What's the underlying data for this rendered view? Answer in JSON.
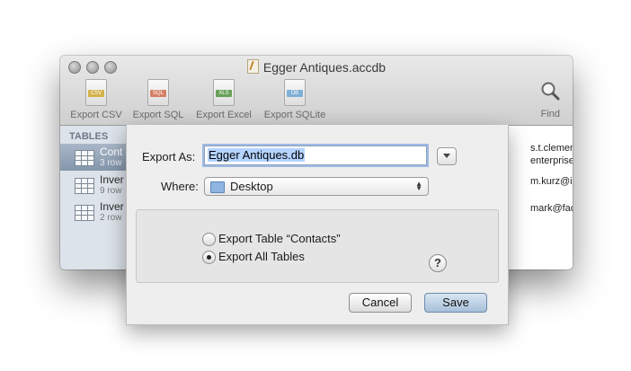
{
  "window": {
    "title": "Egger Antiques.accdb"
  },
  "toolbar": {
    "items": [
      {
        "label": "Export CSV",
        "tag": "CSV",
        "color": "#d4b24a"
      },
      {
        "label": "Export SQL",
        "tag": "SQL",
        "color": "#d47f66"
      },
      {
        "label": "Export Excel",
        "tag": "XLS",
        "color": "#6aa05a"
      },
      {
        "label": "Export SQLite",
        "tag": "DB",
        "color": "#7fb0d6"
      }
    ],
    "find_label": "Find"
  },
  "sidebar": {
    "heading": "TABLES",
    "items": [
      {
        "name": "Cont",
        "sub": "3 row",
        "selected": true
      },
      {
        "name": "Inver",
        "sub": "9 row",
        "selected": false
      },
      {
        "name": "Inver",
        "sub": "2 row",
        "selected": false
      }
    ]
  },
  "content": {
    "cells": [
      "s.t.clemens@territorial-",
      "enterprise.com",
      "m.kurz@imperium.it",
      "mark@facebook.com"
    ]
  },
  "dialog": {
    "export_as_label": "Export As:",
    "filename": "Egger Antiques.db",
    "where_label": "Where:",
    "where_value": "Desktop",
    "options": [
      {
        "label": "Export Table “Contacts”",
        "checked": false
      },
      {
        "label": "Export All Tables",
        "checked": true
      }
    ],
    "help": "?",
    "cancel": "Cancel",
    "save": "Save"
  }
}
